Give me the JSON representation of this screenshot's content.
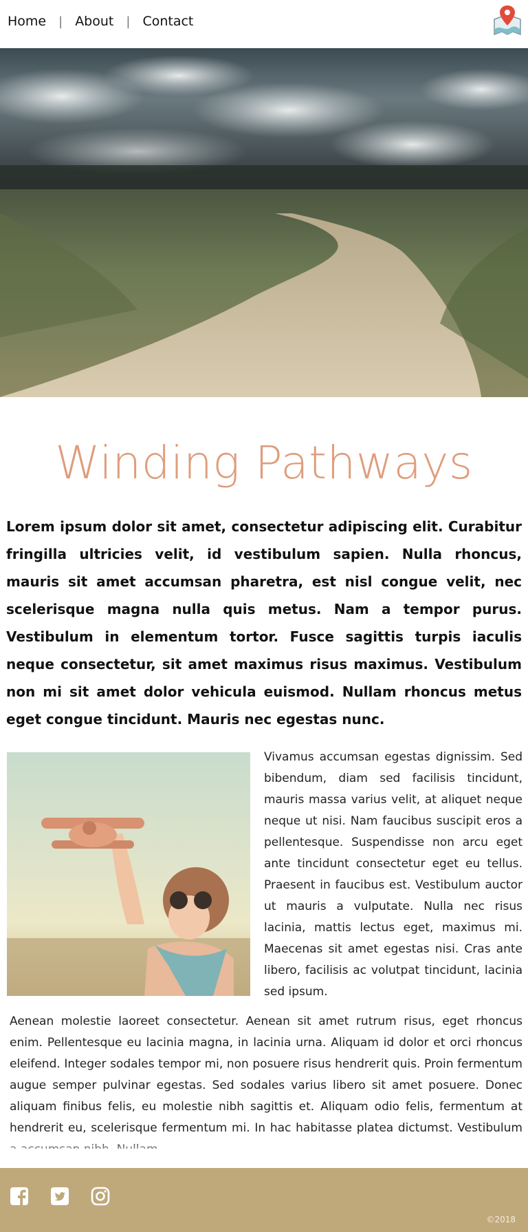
{
  "nav": {
    "items": [
      {
        "label": "Home"
      },
      {
        "label": "About"
      },
      {
        "label": "Contact"
      }
    ],
    "separator": "|",
    "map_icon": "map-pin-icon"
  },
  "hero": {
    "image": "dirt-road-under-cloudy-sky"
  },
  "content": {
    "title": "Winding Pathways",
    "lead": "Lorem ipsum dolor sit amet, consectetur adipiscing elit. Curabitur fringilla ultricies velit, id vestibulum sapien. Nulla rhoncus, mauris sit amet accumsan pharetra, est nisl congue velit, nec scelerisque magna nulla quis metus. Nam a tempor purus. Vestibulum in elementum tortor. Fusce sagittis turpis iaculis neque consectetur, sit amet maximus risus maximus. Vestibulum non mi sit amet dolor vehicula euismod. Nullam rhoncus metus eget congue tincidunt. Mauris nec egestas nunc.",
    "photo": "child-with-toy-airplane",
    "side_text": "Vivamus accumsan egestas dignissim. Sed bibendum, diam sed facilisis tincidunt, mauris massa varius velit, at aliquet neque neque ut nisi. Nam faucibus suscipit eros a pellentesque. Suspendisse non arcu eget ante tincidunt consectetur eget eu tellus. Praesent in faucibus est. Vestibulum auctor ut mauris a vulputate. Nulla nec risus lacinia, mattis lectus eget, maximus mi. Maecenas sit amet egestas nisi. Cras ante libero, facilisis ac volutpat tincidunt, lacinia sed ipsum.",
    "bottom_text": "Aenean molestie laoreet consectetur. Aenean sit amet rutrum risus, eget rhoncus enim. Pellentesque eu lacinia magna, in lacinia urna. Aliquam id dolor et orci rhoncus eleifend. Integer sodales tempor mi, non posuere risus hendrerit quis. Proin fermentum augue semper pulvinar egestas. Sed sodales varius libero sit amet posuere. Donec aliquam finibus felis, eu molestie nibh sagittis et. Aliquam odio felis, fermentum at hendrerit eu, scelerisque fermentum mi. In hac habitasse platea dictumst. Vestibulum a accumsan nibh. Nullam"
  },
  "footer": {
    "social_icons": [
      "facebook-icon",
      "twitter-icon",
      "instagram-icon"
    ],
    "copyright": "©2018",
    "background_color": "#bfa97b"
  },
  "colors": {
    "title": "#df9d7c",
    "text": "#111111"
  }
}
